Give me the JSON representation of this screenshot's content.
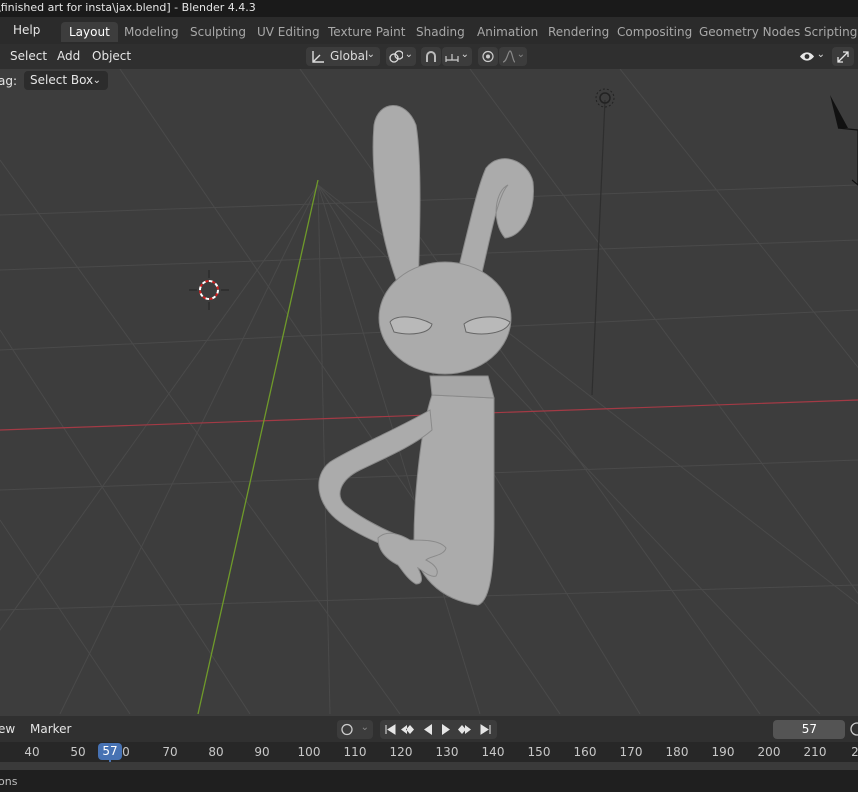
{
  "window": {
    "title": "\\finished art for insta\\jax.blend] - Blender 4.4.3"
  },
  "topbar": {
    "menu_help": "Help",
    "tabs": [
      {
        "label": "Layout",
        "active": true
      },
      {
        "label": "Modeling"
      },
      {
        "label": "Sculpting"
      },
      {
        "label": "UV Editing"
      },
      {
        "label": "Texture Paint"
      },
      {
        "label": "Shading"
      },
      {
        "label": "Animation"
      },
      {
        "label": "Rendering"
      },
      {
        "label": "Compositing"
      },
      {
        "label": "Geometry Nodes"
      },
      {
        "label": "Scripting"
      }
    ]
  },
  "viewport_header": {
    "menus": [
      "Select",
      "Add",
      "Object"
    ],
    "transform_orientation": "Global"
  },
  "tool_settings": {
    "drag_label": "ag:",
    "drag_value": "Select Box"
  },
  "timeline": {
    "menu_view": "ew",
    "menu_marker": "Marker",
    "current_frame": "57",
    "ruler_ticks": [
      "40",
      "50",
      "57",
      "0",
      "70",
      "80",
      "90",
      "100",
      "110",
      "120",
      "130",
      "140",
      "150",
      "160",
      "170",
      "180",
      "190",
      "200",
      "210",
      "2"
    ]
  },
  "statusbar": {
    "left_text": "ons"
  },
  "colors": {
    "x_axis": "#a33a45",
    "y_axis": "#6f9a2a",
    "accent": "#4772b3",
    "model": "#aaaaaa"
  }
}
